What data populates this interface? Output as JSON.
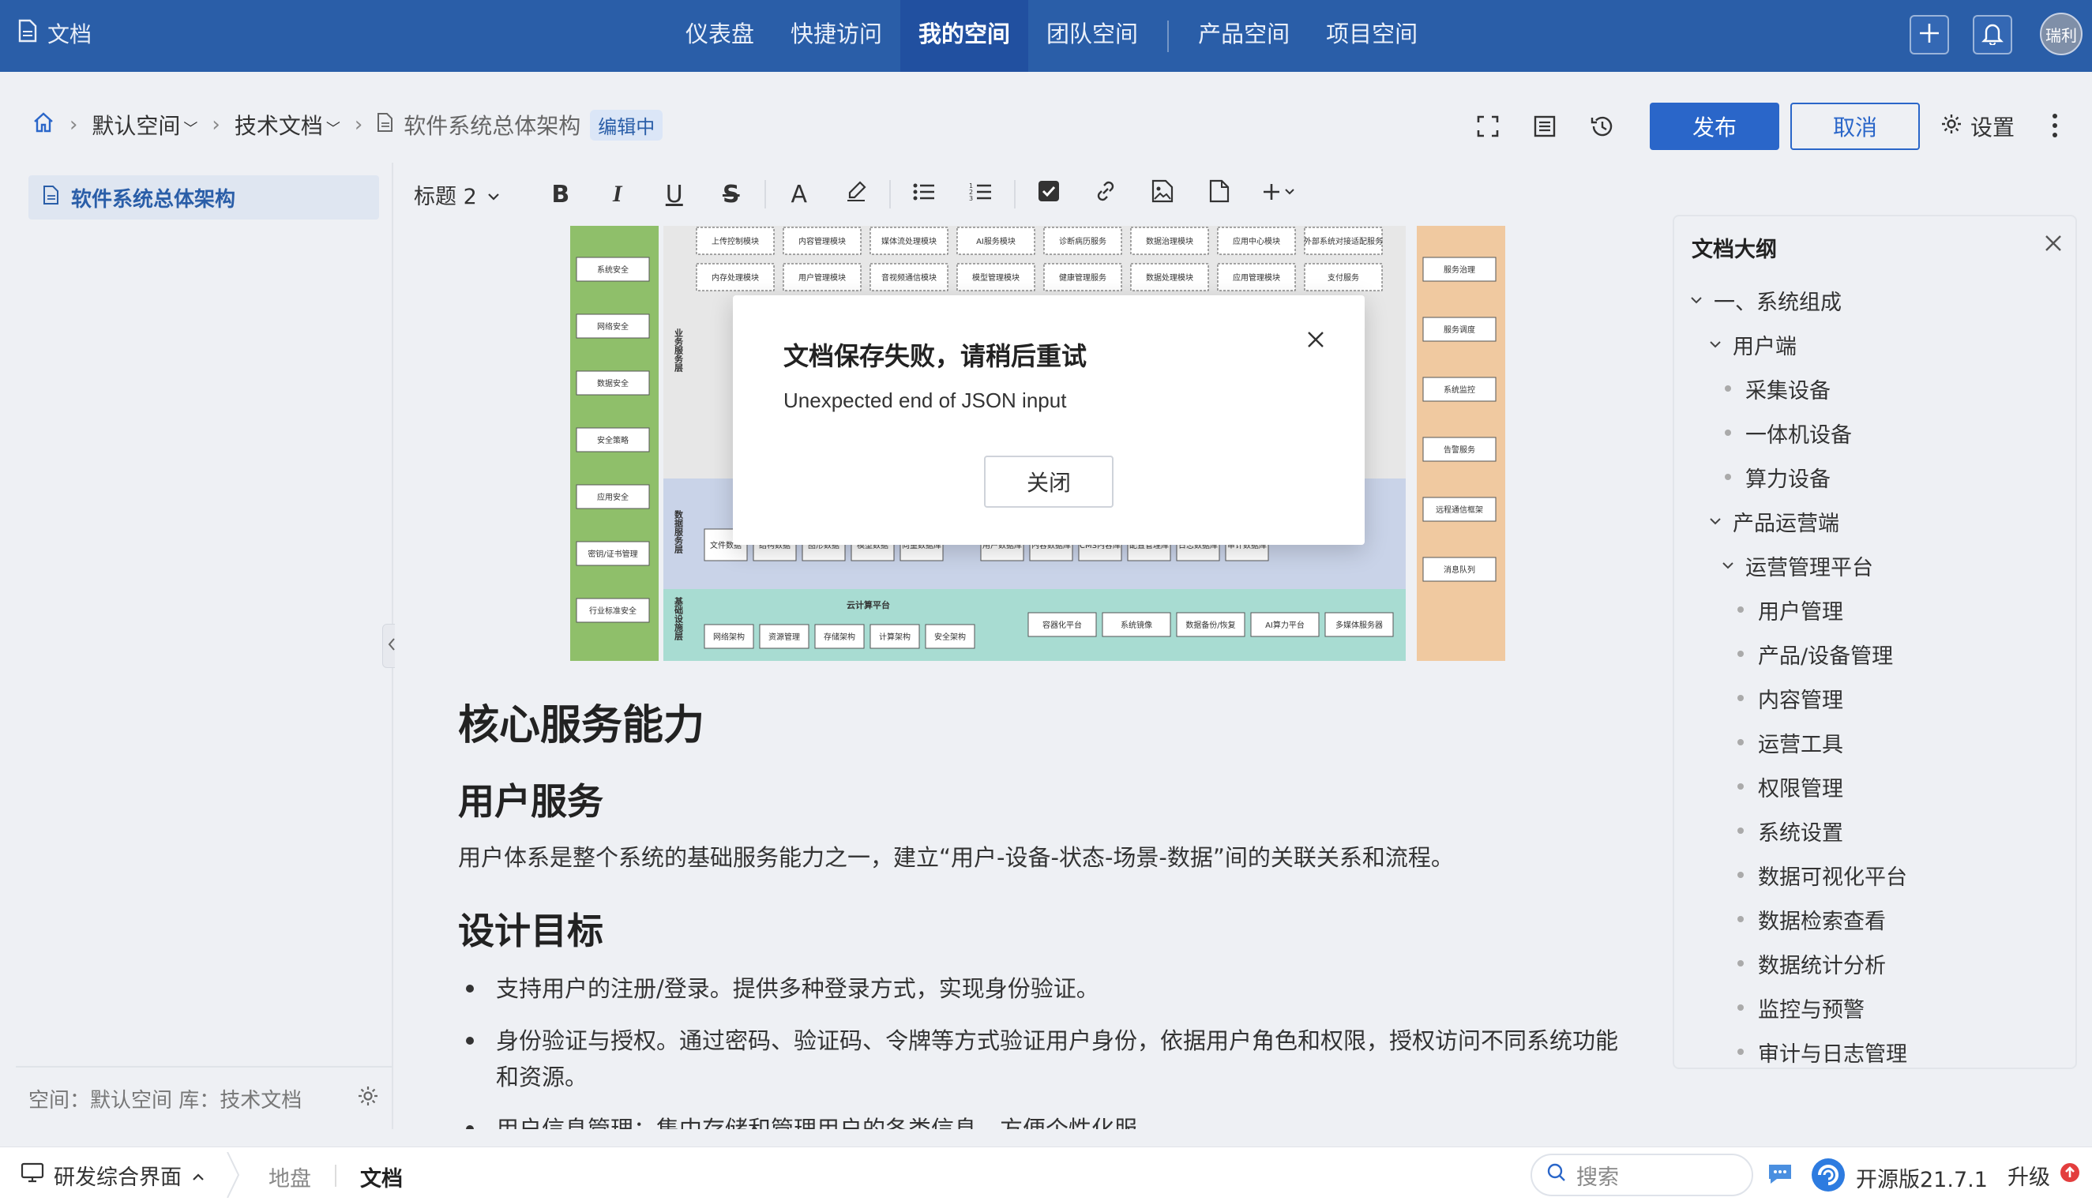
{
  "app": {
    "title": "文档"
  },
  "nav": {
    "tabs": [
      {
        "label": "仪表盘"
      },
      {
        "label": "快捷访问"
      },
      {
        "label": "我的空间"
      },
      {
        "label": "团队空间"
      },
      {
        "label": "产品空间"
      },
      {
        "label": "项目空间"
      }
    ],
    "active": "我的空间",
    "avatar_text": "瑞利"
  },
  "breadcrumb": {
    "space": "默认空间",
    "library": "技术文档",
    "doc": "软件系统总体架构",
    "status_badge": "编辑中"
  },
  "header_actions": {
    "publish": "发布",
    "cancel": "取消",
    "settings": "设置"
  },
  "sidebar": {
    "item": "软件系统总体架构",
    "footer": "空间：默认空间 库：技术文档"
  },
  "toolbar": {
    "heading": "标题 2",
    "bold": "B",
    "italic": "I",
    "underline": "U",
    "strike": "S",
    "font_color": "A"
  },
  "content": {
    "h1": "核心服务能力",
    "h2_user": "用户服务",
    "para": "用户体系是整个系统的基础服务能力之一，建立“用户-设备-状态-场景-数据”间的关联关系和流程。",
    "h2_goal": "设计目标",
    "bullets": [
      "支持用户的注册/登录。提供多种登录方式，实现身份验证。",
      "身份验证与授权。通过密码、验证码、令牌等方式验证用户身份，依据用户角色和权限，授权访问不同系统功能和资源。",
      "用户信息管理：集中存储和管理用户的各类信息，方便个性化服"
    ]
  },
  "diagram": {
    "left_col": [
      "系统安全",
      "网络安全",
      "数据安全",
      "安全策略",
      "应用安全",
      "密钥/证书管理",
      "行业标准安全"
    ],
    "right_col": [
      "服务治理",
      "服务调度",
      "系统监控",
      "告警服务",
      "远程通信框架",
      "消息队列"
    ],
    "row1": [
      "上传控制模块",
      "内容管理模块",
      "媒体流处理模块",
      "AI服务模块",
      "诊断病历服务",
      "数据治理模块",
      "应用中心模块",
      "外部系统对接适配服务"
    ],
    "row2": [
      "内存处理模块",
      "用户管理模块",
      "音视频通信模块",
      "模型管理模块",
      "健康管理服务",
      "数据处理模块",
      "应用管理模块",
      "支付服务"
    ],
    "layer_business": "业务服务层",
    "layer_data": "数据服务层",
    "layer_infra": "基础设施层",
    "data_items": [
      "文件数据",
      "结构数据",
      "图形数据",
      "模型数据",
      "向量数据库"
    ],
    "data_items2": [
      "用户数据库",
      "内容数据库",
      "CMS内容库",
      "配置管理库",
      "日志数据库",
      "审计数据库"
    ],
    "cloud_title": "云计算平台",
    "cloud_items": [
      "网络架构",
      "资源管理",
      "存储架构",
      "计算架构",
      "安全架构"
    ],
    "infra_items": [
      "容器化平台",
      "系统镜像",
      "数据备份/恢复",
      "AI算力平台",
      "多媒体服务器"
    ]
  },
  "outline": {
    "title": "文档大纲",
    "items": [
      {
        "label": "一、系统组成",
        "level": 0,
        "expanded": true
      },
      {
        "label": "用户端",
        "level": 1,
        "expanded": true
      },
      {
        "label": "采集设备",
        "level": 2
      },
      {
        "label": "一体机设备",
        "level": 2
      },
      {
        "label": "算力设备",
        "level": 2
      },
      {
        "label": "产品运营端",
        "level": 1,
        "expanded": true
      },
      {
        "label": "运营管理平台",
        "level": 2,
        "expanded": true
      },
      {
        "label": "用户管理",
        "level": 3
      },
      {
        "label": "产品/设备管理",
        "level": 3
      },
      {
        "label": "内容管理",
        "level": 3
      },
      {
        "label": "运营工具",
        "level": 3
      },
      {
        "label": "权限管理",
        "level": 3
      },
      {
        "label": "系统设置",
        "level": 3
      },
      {
        "label": "数据可视化平台",
        "level": 3
      },
      {
        "label": "数据检索查看",
        "level": 3
      },
      {
        "label": "数据统计分析",
        "level": 3
      },
      {
        "label": "监控与预警",
        "level": 3
      },
      {
        "label": "审计与日志管理",
        "level": 3
      }
    ]
  },
  "modal": {
    "title": "文档保存失败，请稍后重试",
    "message": "Unexpected end of JSON input",
    "close_label": "关闭"
  },
  "statusbar": {
    "workspace": "研发综合界面",
    "tab1": "地盘",
    "tab2": "文档",
    "search_placeholder": "搜索",
    "version": "开源版21.7.1",
    "upgrade": "升级"
  },
  "colors": {
    "primary": "#2a5ea8",
    "accent": "#2a66c9",
    "diagram_green": "#8fbf6a",
    "diagram_orange": "#f0c9a0",
    "diagram_teal": "#a8dcd2"
  }
}
